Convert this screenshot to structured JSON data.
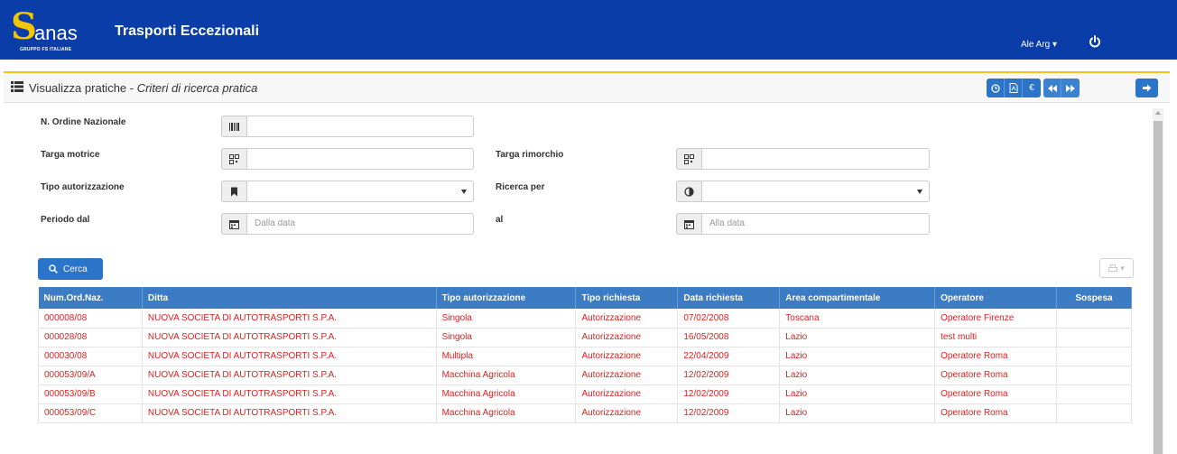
{
  "header": {
    "logo_name": "anas",
    "logo_sub": "GRUPPO FS ITALIANE",
    "app_title": "Trasporti Eccezionali",
    "user": "Ale Arg ▾"
  },
  "panel": {
    "title": "Visualizza pratiche - ",
    "subtitle": "Criteri di ricerca pratica"
  },
  "form": {
    "ordine_label": "N. Ordine Nazionale",
    "targa_motrice_label": "Targa motrice",
    "targa_rimorchio_label": "Targa rimorchio",
    "tipo_aut_label": "Tipo autorizzazione",
    "ricerca_per_label": "Ricerca per",
    "periodo_label": "Periodo dal",
    "al_label": "al",
    "dalla_data_placeholder": "Dalla data",
    "alla_data_placeholder": "Alla data"
  },
  "cerca_label": "Cerca",
  "table": {
    "columns": [
      "Num.Ord.Naz.",
      "Ditta",
      "Tipo autorizzazione",
      "Tipo richiesta",
      "Data richiesta",
      "Area compartimentale",
      "Operatore",
      "Sospesa"
    ],
    "rows": [
      [
        "000008/08",
        "NUOVA SOCIETA DI AUTOTRASPORTI S.P.A.",
        "Singola",
        "Autorizzazione",
        "07/02/2008",
        "Toscana",
        "Operatore Firenze",
        ""
      ],
      [
        "000028/08",
        "NUOVA SOCIETA DI AUTOTRASPORTI S.P.A.",
        "Singola",
        "Autorizzazione",
        "16/05/2008",
        "Lazio",
        "test multi",
        ""
      ],
      [
        "000030/08",
        "NUOVA SOCIETA DI AUTOTRASPORTI S.P.A.",
        "Multipla",
        "Autorizzazione",
        "22/04/2009",
        "Lazio",
        "Operatore Roma",
        ""
      ],
      [
        "000053/09/A",
        "NUOVA SOCIETA DI AUTOTRASPORTI S.P.A.",
        "Macchina Agricola",
        "Autorizzazione",
        "12/02/2009",
        "Lazio",
        "Operatore Roma",
        ""
      ],
      [
        "000053/09/B",
        "NUOVA SOCIETA DI AUTOTRASPORTI S.P.A.",
        "Macchina Agricola",
        "Autorizzazione",
        "12/02/2009",
        "Lazio",
        "Operatore Roma",
        ""
      ],
      [
        "000053/09/C",
        "NUOVA SOCIETA DI AUTOTRASPORTI S.P.A.",
        "Macchina Agricola",
        "Autorizzazione",
        "12/02/2009",
        "Lazio",
        "Operatore Roma",
        ""
      ]
    ]
  },
  "colors": {
    "header_bg": "#0a3da8",
    "accent_yellow": "#f0c419",
    "button_blue": "#2a74c9",
    "table_header": "#3b7cc4",
    "row_text": "#e02020"
  },
  "icons": {
    "ordine": "barcode-icon",
    "targa": "qrcode-icon",
    "tipo": "bookmark-icon",
    "ricerca": "adjust-icon",
    "periodo": "calendar-icon"
  }
}
